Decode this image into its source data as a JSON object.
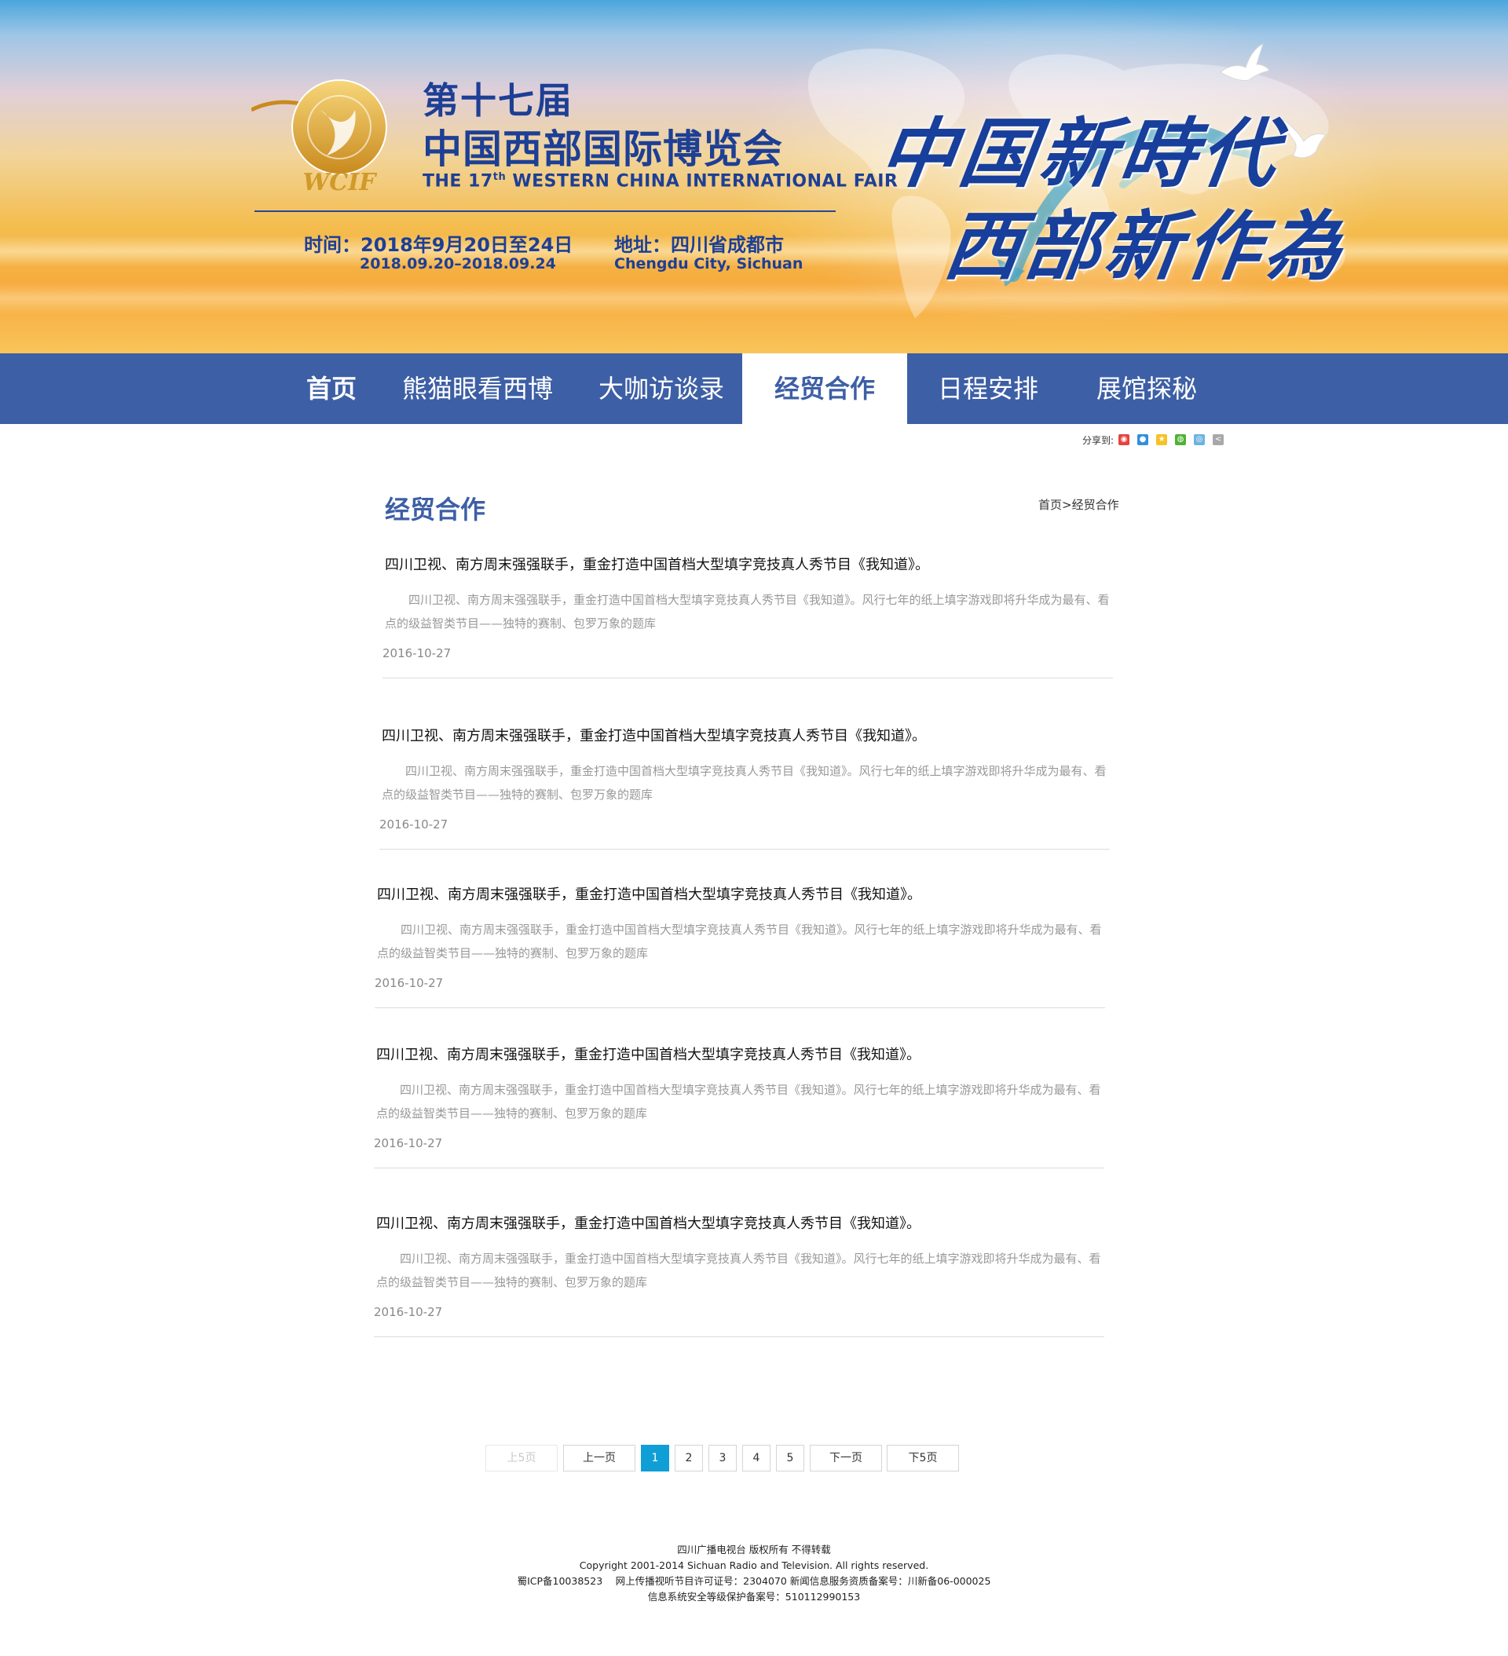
{
  "banner": {
    "logo_text": "WCIF",
    "edition_cn": "第十七届",
    "fair_cn": "中国西部国际博览会",
    "fair_en_prefix": "THE 17",
    "fair_en_sup": "th",
    "fair_en_suffix": " WESTERN CHINA INTERNATIONAL FAIR",
    "date_cn": "时间：2018年9月20日至24日",
    "date_en": "2018.09.20–2018.09.24",
    "address_cn": "地址：四川省成都市",
    "address_en": "Chengdu City, Sichuan",
    "slogan_line1": "中国新時代",
    "slogan_line2": "西部新作為"
  },
  "nav": {
    "items": [
      {
        "label": "首页"
      },
      {
        "label": "熊猫眼看西博"
      },
      {
        "label": "大咖访谈录"
      },
      {
        "label": "经贸合作"
      },
      {
        "label": "日程安排"
      },
      {
        "label": "展馆探秘"
      }
    ],
    "active_index": 3
  },
  "share": {
    "label": "分享到:",
    "icons": [
      "weibo-icon",
      "qq-icon",
      "qzone-icon",
      "wechat-icon",
      "renren-icon",
      "more-share-icon"
    ]
  },
  "section": {
    "title": "经贸合作",
    "breadcrumb": "首页>经贸合作"
  },
  "articles": [
    {
      "title": "四川卫视、南方周末强强联手，重金打造中国首档大型填字竞技真人秀节目《我知道》。",
      "summary": "四川卫视、南方周末强强联手，重金打造中国首档大型填字竞技真人秀节目《我知道》。风行七年的纸上填字游戏即将升华成为最有、看点的级益智类节目——独特的赛制、包罗万象的题库",
      "date": "2016-10-27"
    },
    {
      "title": "四川卫视、南方周末强强联手，重金打造中国首档大型填字竞技真人秀节目《我知道》。",
      "summary": "四川卫视、南方周末强强联手，重金打造中国首档大型填字竞技真人秀节目《我知道》。风行七年的纸上填字游戏即将升华成为最有、看点的级益智类节目——独特的赛制、包罗万象的题库",
      "date": "2016-10-27"
    },
    {
      "title": "四川卫视、南方周末强强联手，重金打造中国首档大型填字竞技真人秀节目《我知道》。",
      "summary": "四川卫视、南方周末强强联手，重金打造中国首档大型填字竞技真人秀节目《我知道》。风行七年的纸上填字游戏即将升华成为最有、看点的级益智类节目——独特的赛制、包罗万象的题库",
      "date": "2016-10-27"
    },
    {
      "title": "四川卫视、南方周末强强联手，重金打造中国首档大型填字竞技真人秀节目《我知道》。",
      "summary": "四川卫视、南方周末强强联手，重金打造中国首档大型填字竞技真人秀节目《我知道》。风行七年的纸上填字游戏即将升华成为最有、看点的级益智类节目——独特的赛制、包罗万象的题库",
      "date": "2016-10-27"
    },
    {
      "title": "四川卫视、南方周末强强联手，重金打造中国首档大型填字竞技真人秀节目《我知道》。",
      "summary": "四川卫视、南方周末强强联手，重金打造中国首档大型填字竞技真人秀节目《我知道》。风行七年的纸上填字游戏即将升华成为最有、看点的级益智类节目——独特的赛制、包罗万象的题库",
      "date": "2016-10-27"
    }
  ],
  "pagination": {
    "prev5": "上5页",
    "prev": "上一页",
    "pages": [
      "1",
      "2",
      "3",
      "4",
      "5"
    ],
    "current": "1",
    "next": "下一页",
    "next5": "下5页"
  },
  "footer": {
    "line1": "四川广播电视台 版权所有 不得转载",
    "line2": "Copyright 2001-2014 Sichuan Radio and Television. All rights reserved.",
    "line3": "蜀ICP备10038523　 网上传播视听节目许可证号：2304070 新闻信息服务资质备案号：川新备06-000025",
    "line4": "信息系统安全等级保护备案号：510112990153"
  },
  "colors": {
    "nav_bg": "#3d5fa5",
    "brand_blue": "#1d3f95",
    "pager_active": "#0f9fd6"
  }
}
